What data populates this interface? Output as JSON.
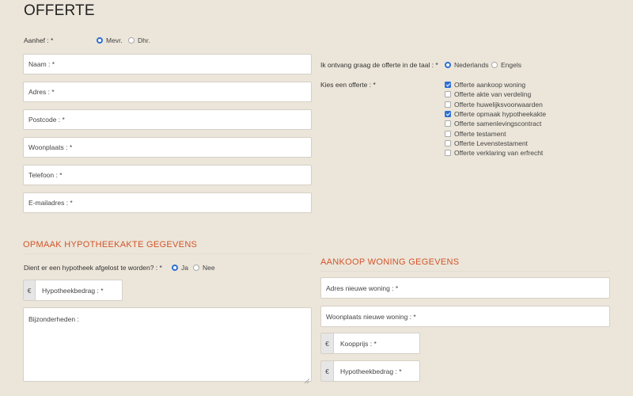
{
  "page": {
    "title": "OFFERTE"
  },
  "personal": {
    "salutation": {
      "label": "Aanhef : *",
      "options": [
        "Mevr.",
        "Dhr."
      ],
      "selected": "Mevr."
    },
    "fields": [
      {
        "placeholder": "Naam : *"
      },
      {
        "placeholder": "Adres : *"
      },
      {
        "placeholder": "Postcode : *"
      },
      {
        "placeholder": "Woonplaats : *"
      },
      {
        "placeholder": "Telefoon : *"
      },
      {
        "placeholder": "E-mailadres : *"
      }
    ]
  },
  "language": {
    "label": "Ik ontvang graag de offerte in de taal : *",
    "options": [
      "Nederlands",
      "Engels"
    ],
    "selected": "Nederlands"
  },
  "offer_choice": {
    "label": "Kies een offerte : *",
    "options": [
      {
        "label": "Offerte aankoop woning",
        "checked": true
      },
      {
        "label": "Offerte akte van verdeling",
        "checked": false
      },
      {
        "label": "Offerte huwelijksvoorwaarden",
        "checked": false
      },
      {
        "label": "Offerte opmaak hypotheekakte",
        "checked": true
      },
      {
        "label": "Offerte samenlevingscontract",
        "checked": false
      },
      {
        "label": "Offerte testament",
        "checked": false
      },
      {
        "label": "Offerte Levenstestament",
        "checked": false
      },
      {
        "label": "Offerte verklaring van erfrecht",
        "checked": false
      }
    ]
  },
  "mortgage_section": {
    "heading": "OPMAAK HYPOTHEEKAKTE GEGEVENS",
    "question": "Dient er een hypotheek afgelost te worden? : *",
    "options": [
      "Ja",
      "Nee"
    ],
    "selected": "Ja",
    "currency_symbol": "€",
    "amount_placeholder": "Hypotheekbedrag : *",
    "details_placeholder": "Bijzonderheden :"
  },
  "purchase_section": {
    "heading": "AANKOOP WONING GEGEVENS",
    "address_placeholder": "Adres nieuwe woning : *",
    "city_placeholder": "Woonplaats nieuwe woning : *",
    "currency_symbol": "€",
    "price_placeholder": "Koopprijs : *",
    "mortgage_placeholder": "Hypotheekbedrag : *"
  },
  "colors": {
    "background": "#ece6da",
    "accent": "#d2542a",
    "checked": "#2f6fd4"
  }
}
